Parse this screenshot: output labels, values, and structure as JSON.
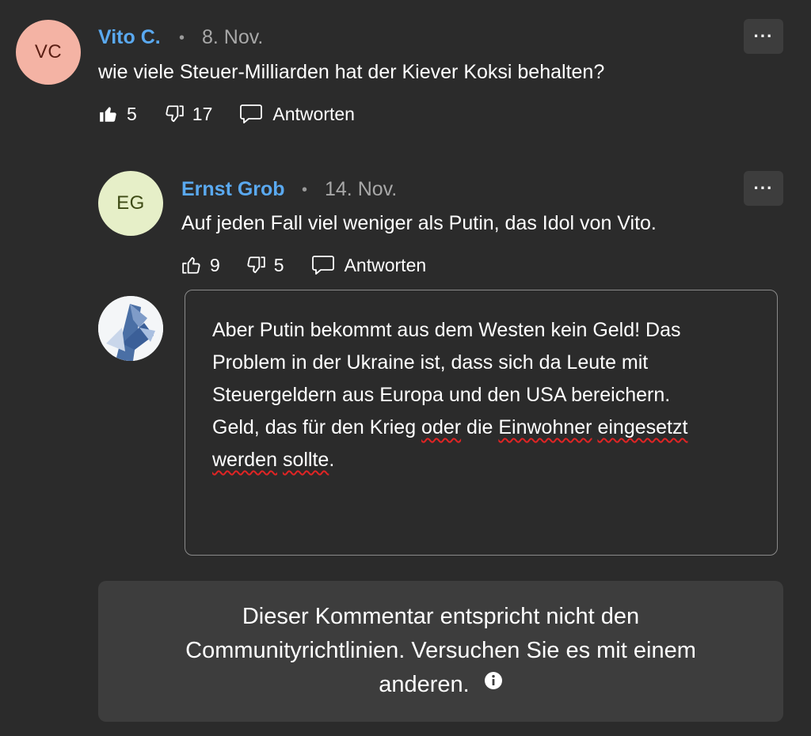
{
  "comments": [
    {
      "initials": "VC",
      "author": "Vito C.",
      "separator": "•",
      "date": "8. Nov.",
      "text": "wie viele Steuer-Milliarden hat der Kiever Koksi behalten?",
      "likes": "5",
      "dislikes": "17",
      "reply_label": "Antworten",
      "more_label": "···",
      "avatar_bg": "#f4b3a4",
      "avatar_fg": "#5a1f14"
    },
    {
      "initials": "EG",
      "author": "Ernst Grob",
      "separator": "•",
      "date": "14. Nov.",
      "text": "Auf jeden Fall viel weniger als Putin, das Idol von Vito.",
      "likes": "9",
      "dislikes": "5",
      "reply_label": "Antworten",
      "more_label": "···",
      "avatar_bg": "#e6efc8",
      "avatar_fg": "#3d4a14"
    }
  ],
  "reply_draft": {
    "line1": "Aber Putin bekommt aus dem Westen kein Geld! Das",
    "line2": "Problem in der Ukraine ist, dass sich da Leute mit",
    "line3": "Steuergeldern aus Europa und den USA bereichern.",
    "line4_a": "Geld, das für den Krieg ",
    "line4_b": "oder",
    "line4_c": " die ",
    "line4_d": "Einwohner",
    "line4_e": " ",
    "line4_f": "eingesetzt",
    "line5_a": "werden",
    "line5_b": " ",
    "line5_c": "sollte",
    "line5_d": "."
  },
  "notice": {
    "text": "Dieser Kommentar entspricht nicht den Communityrichtlinien. Versuchen Sie es mit einem anderen.",
    "icon": "info-icon"
  },
  "colors": {
    "background": "#2b2b2b",
    "author": "#5aa9f0",
    "panel": "#3d3d3d",
    "spellcheck": "#e02424"
  }
}
